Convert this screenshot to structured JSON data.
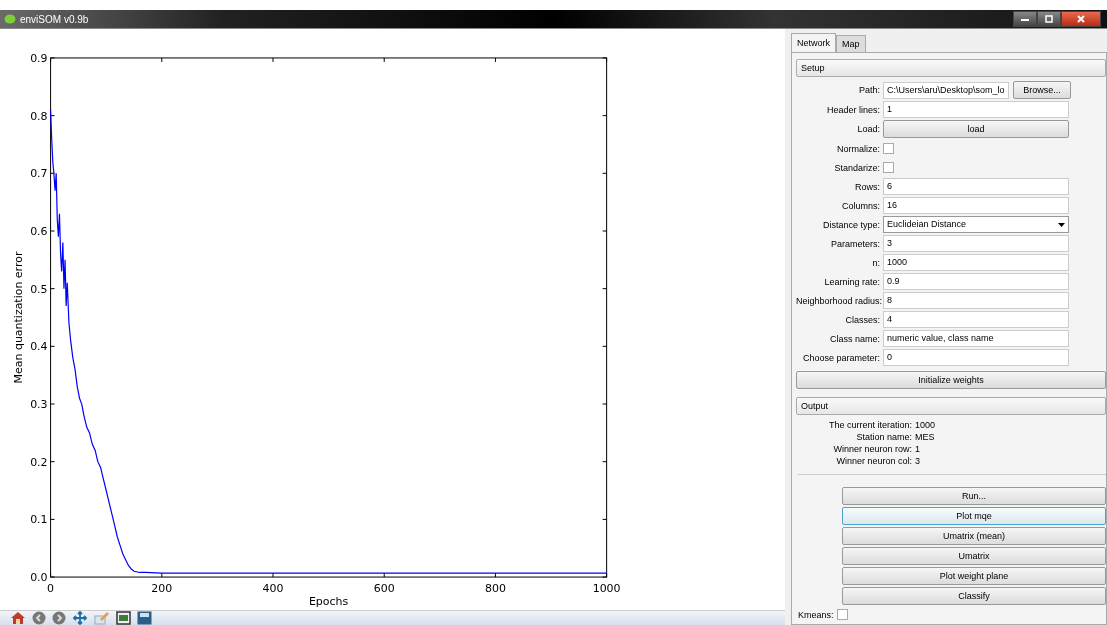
{
  "window": {
    "title": "enviSOM v0.9b"
  },
  "plot": {
    "chart_data": {
      "type": "line",
      "xlabel": "Epochs",
      "ylabel": "Mean quantization error",
      "xlim": [
        0,
        1000
      ],
      "ylim": [
        0,
        0.9
      ],
      "xticks": [
        0,
        200,
        400,
        600,
        800,
        1000
      ],
      "yticks": [
        {
          "value": 0,
          "label": "0.0"
        },
        {
          "value": 0.1,
          "label": "0.1"
        },
        {
          "value": 0.2,
          "label": "0.2"
        },
        {
          "value": 0.3,
          "label": "0.3"
        },
        {
          "value": 0.4,
          "label": "0.4"
        },
        {
          "value": 0.5,
          "label": "0.5"
        },
        {
          "value": 0.6,
          "label": "0.6"
        },
        {
          "value": 0.7,
          "label": "0.7"
        },
        {
          "value": 0.8,
          "label": "0.8"
        },
        {
          "value": 0.9,
          "label": "0.9"
        }
      ],
      "x": [
        0,
        2,
        4,
        6,
        8,
        10,
        12,
        14,
        16,
        18,
        20,
        22,
        24,
        26,
        28,
        30,
        33,
        36,
        40,
        44,
        48,
        52,
        56,
        60,
        65,
        70,
        75,
        80,
        85,
        90,
        95,
        100,
        105,
        110,
        115,
        120,
        125,
        130,
        135,
        140,
        145,
        150,
        160,
        170,
        200,
        400,
        600,
        800,
        1000
      ],
      "series": [
        {
          "color": "#0000ff",
          "values": [
            0.81,
            0.76,
            0.72,
            0.7,
            0.67,
            0.7,
            0.62,
            0.59,
            0.63,
            0.56,
            0.53,
            0.58,
            0.5,
            0.55,
            0.47,
            0.51,
            0.44,
            0.41,
            0.38,
            0.36,
            0.33,
            0.31,
            0.3,
            0.28,
            0.26,
            0.25,
            0.23,
            0.22,
            0.2,
            0.19,
            0.17,
            0.15,
            0.13,
            0.11,
            0.09,
            0.07,
            0.055,
            0.04,
            0.03,
            0.02,
            0.014,
            0.01,
            0.008,
            0.008,
            0.007,
            0.007,
            0.007,
            0.007,
            0.007
          ]
        }
      ]
    }
  },
  "toolbar": [
    {
      "kind": "home"
    },
    {
      "kind": "back"
    },
    {
      "kind": "forward"
    },
    {
      "kind": "move"
    },
    {
      "kind": "edit"
    },
    {
      "kind": "subplots"
    },
    {
      "kind": "save"
    }
  ],
  "tabs": [
    {
      "label": "Network",
      "selected": true
    },
    {
      "label": "Map",
      "selected": false
    }
  ],
  "setup": {
    "title": "Setup",
    "rows": [
      {
        "kind": "path",
        "label": "Path:",
        "value": "C:\\Users\\aru\\Desktop\\som_lo",
        "button": "Browse..."
      },
      {
        "kind": "field",
        "label": "Header lines:",
        "value": "1"
      },
      {
        "kind": "button",
        "label": "Load:",
        "button": "load"
      },
      {
        "kind": "checkbox",
        "label": "Normalize:",
        "checked": false
      },
      {
        "kind": "checkbox",
        "label": "Standarize:",
        "checked": false
      },
      {
        "kind": "field",
        "label": "Rows:",
        "value": "6"
      },
      {
        "kind": "field",
        "label": "Columns:",
        "value": "16"
      },
      {
        "kind": "select",
        "label": "Distance type:",
        "value": "Euclideian Distance"
      },
      {
        "kind": "field",
        "label": "Parameters:",
        "value": "3"
      },
      {
        "kind": "field",
        "label": "n:",
        "value": "1000"
      },
      {
        "kind": "field",
        "label": "Learning rate:",
        "value": "0.9"
      },
      {
        "kind": "field",
        "label": "Neighborhood radius:",
        "value": "8"
      },
      {
        "kind": "field",
        "label": "Classes:",
        "value": "4"
      },
      {
        "kind": "field",
        "label": "Class name:",
        "value": "numeric value, class name"
      },
      {
        "kind": "field",
        "label": "Choose parameter:",
        "value": "0"
      }
    ],
    "init_button": "Initialize weights"
  },
  "output": {
    "title": "Output",
    "lines": [
      {
        "label": "The current iteration:",
        "value": "1000"
      },
      {
        "label": "Station name:",
        "value": "MES"
      },
      {
        "label": "Winner neuron row:",
        "value": "1"
      },
      {
        "label": "Winner neuron col:",
        "value": "3"
      }
    ]
  },
  "actions": [
    {
      "label": "Run...",
      "focused": false
    },
    {
      "label": "Plot mqe",
      "focused": true
    },
    {
      "label": "Umatrix (mean)",
      "focused": false
    },
    {
      "label": "Umatrix",
      "focused": false
    },
    {
      "label": "Plot weight plane",
      "focused": false
    },
    {
      "label": "Classify",
      "focused": false
    }
  ],
  "kmeans": {
    "label": "Kmeans:",
    "checked": false
  }
}
